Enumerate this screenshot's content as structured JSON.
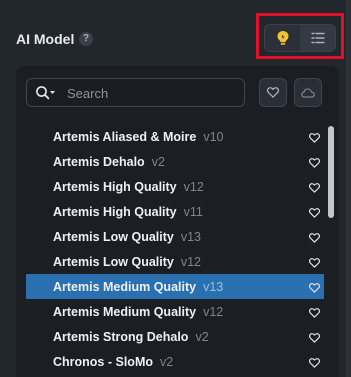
{
  "header": {
    "title": "AI Model",
    "help_glyph": "?"
  },
  "toggle": {
    "left_icon": "lightbulb-icon",
    "right_icon": "list-settings-icon"
  },
  "search": {
    "placeholder": "Search",
    "value": ""
  },
  "buttons": {
    "favorites_icon": "heart-icon",
    "cloud_icon": "cloud-icon"
  },
  "models": [
    {
      "name": "Artemis Aliased & Moire",
      "version": "v10",
      "selected": false
    },
    {
      "name": "Artemis Dehalo",
      "version": "v2",
      "selected": false
    },
    {
      "name": "Artemis High Quality",
      "version": "v12",
      "selected": false
    },
    {
      "name": "Artemis High Quality",
      "version": "v11",
      "selected": false
    },
    {
      "name": "Artemis Low Quality",
      "version": "v13",
      "selected": false
    },
    {
      "name": "Artemis Low Quality",
      "version": "v12",
      "selected": false
    },
    {
      "name": "Artemis Medium Quality",
      "version": "v13",
      "selected": true
    },
    {
      "name": "Artemis Medium Quality",
      "version": "v12",
      "selected": false
    },
    {
      "name": "Artemis Strong Dehalo",
      "version": "v2",
      "selected": false
    },
    {
      "name": "Chronos - SloMo",
      "version": "v2",
      "selected": false
    }
  ],
  "colors": {
    "selection": "#2a6fb0",
    "highlight_frame": "#e2112a",
    "bulb": "#f2c230"
  }
}
